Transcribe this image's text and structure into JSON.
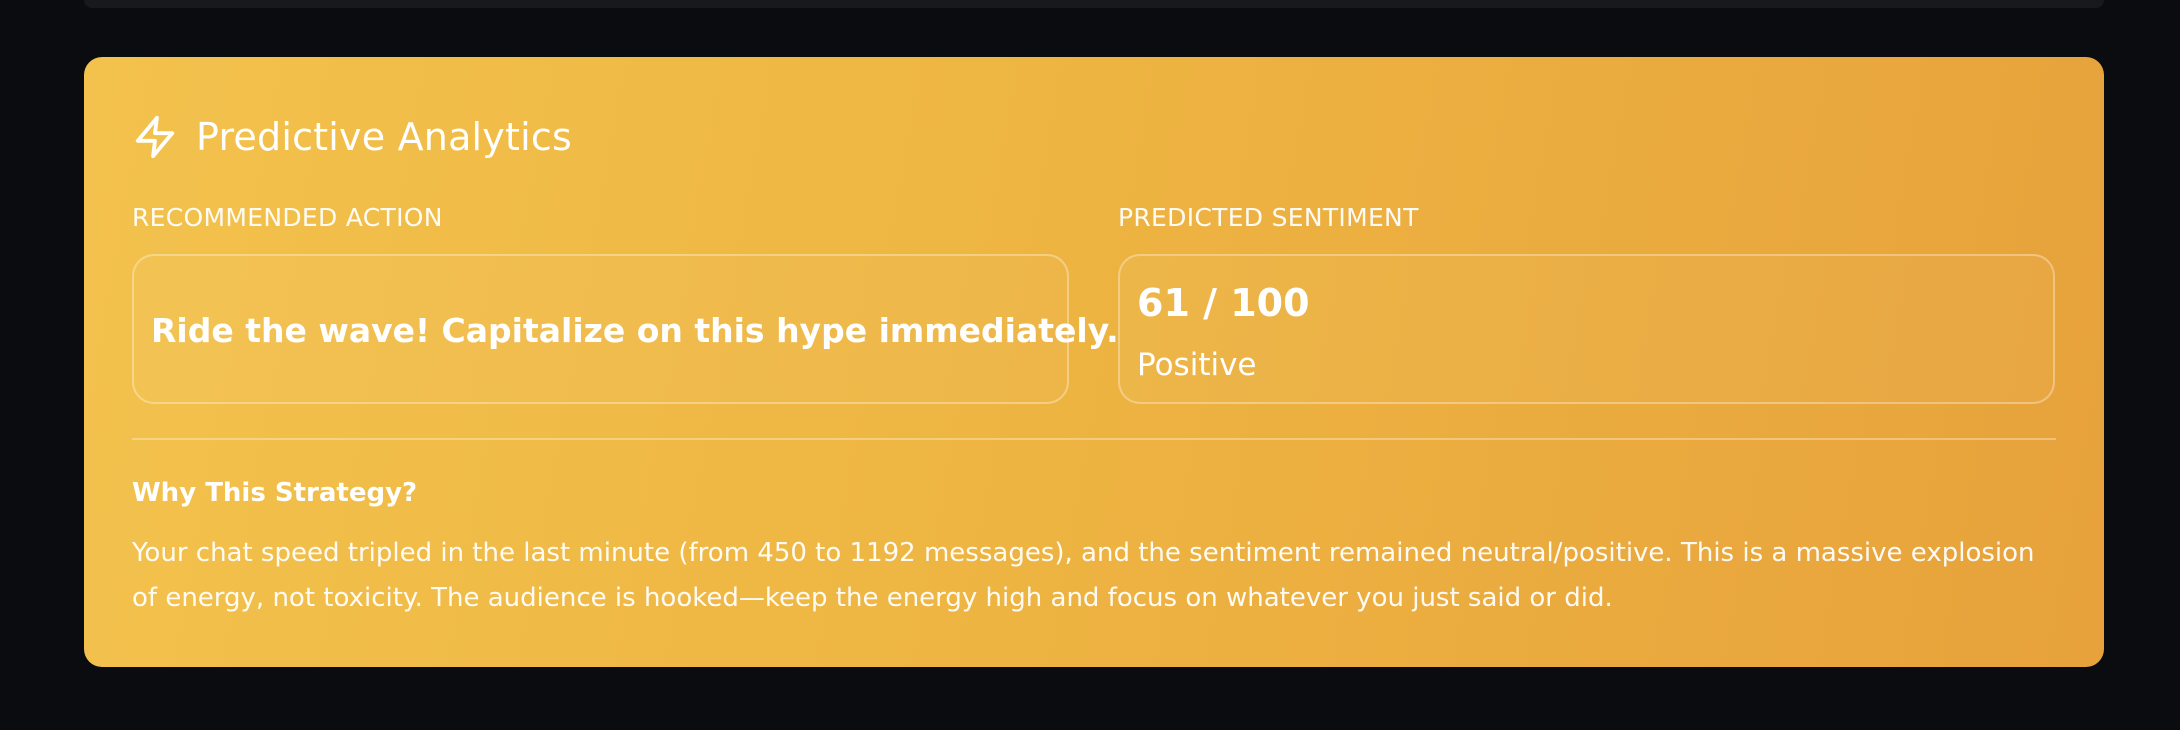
{
  "card": {
    "title": "Predictive Analytics",
    "icon": "lightning-bolt-icon",
    "background_colors": [
      "#f3c24d",
      "#e7a23b"
    ]
  },
  "recommended_action": {
    "label": "RECOMMENDED ACTION",
    "text": "Ride the wave! Capitalize on this hype immediately."
  },
  "predicted_sentiment": {
    "label": "PREDICTED SENTIMENT",
    "score": "61 / 100",
    "sentiment": "Positive"
  },
  "strategy": {
    "heading": "Why This Strategy?",
    "body": "Your chat speed tripled in the last minute (from 450 to 1192 messages), and the sentiment remained neutral/positive. This is a massive explosion of energy, not toxicity. The audience is hooked—keep the energy high and focus on whatever you just said or did."
  }
}
